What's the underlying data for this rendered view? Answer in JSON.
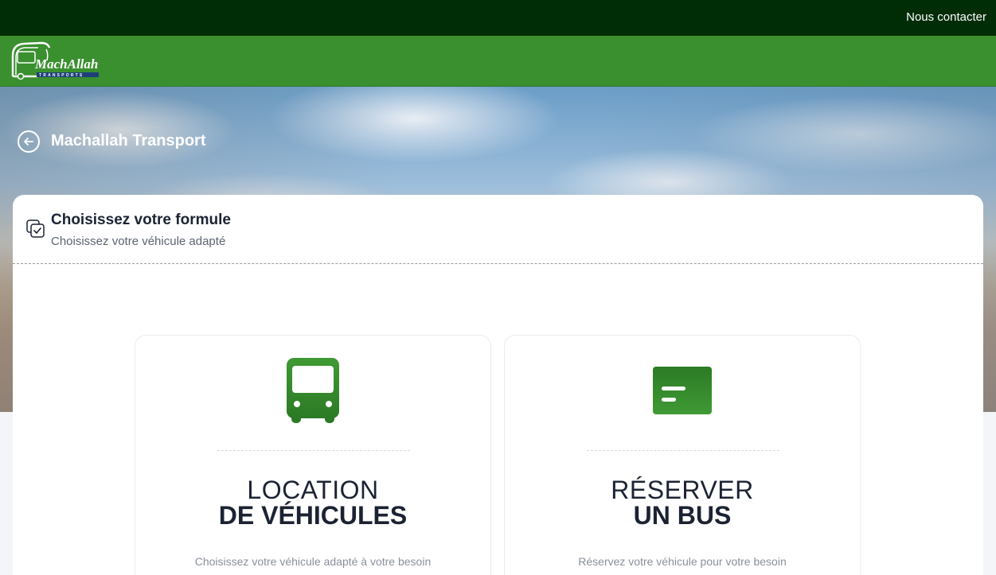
{
  "topbar": {
    "contact_label": "Nous contacter"
  },
  "logo": {
    "text": "MachAllah",
    "subtext": "TRANSPORTS"
  },
  "hero": {
    "title": "Machallah Transport"
  },
  "panel": {
    "title": "Choisissez votre formule",
    "subtitle": "Choisissez votre véhicule adapté"
  },
  "cards": [
    {
      "line1": "LOCATION",
      "line2": "DE VÉHICULES",
      "description": "Choisissez votre véhicule adapté à votre besoin",
      "icon": "bus-icon"
    },
    {
      "line1": "RÉSERVER",
      "line2": "UN BUS",
      "description": "Réservez votre véhicule pour votre besoin",
      "icon": "ticket-icon"
    }
  ],
  "colors": {
    "topbar": "#002d05",
    "brand_green": "#3a8f2f",
    "text_dark": "#1b2333",
    "text_muted": "#8a909b"
  }
}
